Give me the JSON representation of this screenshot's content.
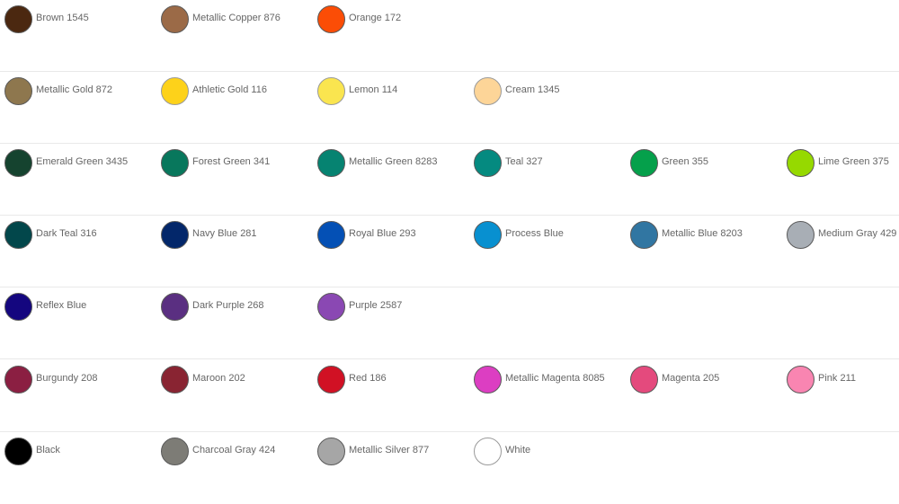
{
  "rows": [
    [
      {
        "name": "Brown 1545",
        "color": "#4b2810"
      },
      {
        "name": "Metallic Copper 876",
        "color": "#9b6a47"
      },
      {
        "name": "Orange 172",
        "color": "#fb4d06"
      }
    ],
    [
      {
        "name": "Metallic Gold 872",
        "color": "#8e774e"
      },
      {
        "name": "Athletic Gold 116",
        "color": "#fdd21a"
      },
      {
        "name": "Lemon 114",
        "color": "#fae54f"
      },
      {
        "name": "Cream 1345",
        "color": "#fdd598"
      }
    ],
    [
      {
        "name": "Emerald Green 3435",
        "color": "#15432f"
      },
      {
        "name": "Forest Green 341",
        "color": "#08775c"
      },
      {
        "name": "Metallic Green 8283",
        "color": "#068371"
      },
      {
        "name": "Teal 327",
        "color": "#058a80"
      },
      {
        "name": "Green 355",
        "color": "#05a04b"
      },
      {
        "name": "Lime Green 375",
        "color": "#96d900"
      }
    ],
    [
      {
        "name": "Dark Teal 316",
        "color": "#02474b"
      },
      {
        "name": "Navy Blue 281",
        "color": "#03276a"
      },
      {
        "name": "Royal Blue 293",
        "color": "#0450b5"
      },
      {
        "name": "Process Blue",
        "color": "#0890d0"
      },
      {
        "name": "Metallic Blue 8203",
        "color": "#3176a2"
      },
      {
        "name": "Medium Gray 429",
        "color": "#a8aeb5"
      }
    ],
    [
      {
        "name": "Reflex Blue",
        "color": "#14067f"
      },
      {
        "name": "Dark Purple 268",
        "color": "#5a2f81"
      },
      {
        "name": "Purple 2587",
        "color": "#8a48b3"
      }
    ],
    [
      {
        "name": "Burgundy 208",
        "color": "#8b1f42"
      },
      {
        "name": "Maroon 202",
        "color": "#892432"
      },
      {
        "name": "Red 186",
        "color": "#d11124"
      },
      {
        "name": "Metallic Magenta 8085",
        "color": "#dc3ec2"
      },
      {
        "name": "Magenta 205",
        "color": "#e44a7d"
      },
      {
        "name": "Pink 211",
        "color": "#f985b1"
      }
    ],
    [
      {
        "name": "Black",
        "color": "#000000"
      },
      {
        "name": "Charcoal Gray 424",
        "color": "#7d7c76"
      },
      {
        "name": "Metallic Silver 877",
        "color": "#a6a6a6"
      },
      {
        "name": "White",
        "color": "#ffffff"
      }
    ]
  ]
}
